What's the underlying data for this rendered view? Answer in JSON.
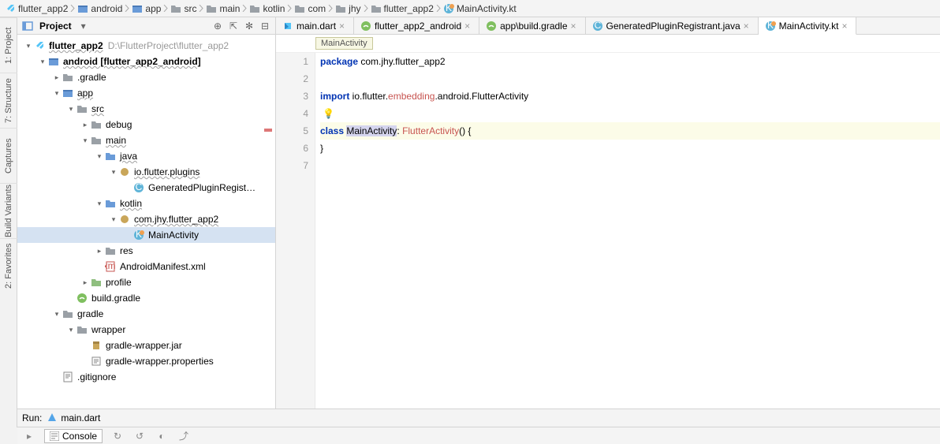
{
  "breadcrumbs": [
    "flutter_app2",
    "android",
    "app",
    "src",
    "main",
    "kotlin",
    "com",
    "jhy",
    "flutter_app2",
    "MainActivity.kt"
  ],
  "sidebar_tools": [
    "1: Project",
    "7: Structure",
    "Captures",
    "Build Variants",
    "2: Favorites"
  ],
  "project_panel": {
    "title": "Project"
  },
  "tree": [
    {
      "d": 0,
      "arr": "v",
      "icn": "flutter",
      "lab": "flutter_app2",
      "hint": "D:\\FlutterProject\\flutter_app2",
      "bold": true,
      "u": true
    },
    {
      "d": 1,
      "arr": "v",
      "icn": "module",
      "lab": "android  [flutter_app2_android]",
      "bold": true,
      "u": true
    },
    {
      "d": 2,
      "arr": ">",
      "icn": "folder-d",
      "lab": ".gradle"
    },
    {
      "d": 2,
      "arr": "v",
      "icn": "module",
      "lab": "app",
      "u": true
    },
    {
      "d": 3,
      "arr": "v",
      "icn": "folder-d",
      "lab": "src",
      "u": true
    },
    {
      "d": 4,
      "arr": ">",
      "icn": "folder-d",
      "lab": "debug"
    },
    {
      "d": 4,
      "arr": "v",
      "icn": "folder-d",
      "lab": "main",
      "u": true
    },
    {
      "d": 5,
      "arr": "v",
      "icn": "folder-b",
      "lab": "java",
      "u": true
    },
    {
      "d": 6,
      "arr": "v",
      "icn": "pkg",
      "lab": "io.flutter.plugins",
      "u": true
    },
    {
      "d": 7,
      "arr": "",
      "icn": "cfile",
      "lab": "GeneratedPluginRegist…"
    },
    {
      "d": 5,
      "arr": "v",
      "icn": "folder-b",
      "lab": "kotlin",
      "u": true
    },
    {
      "d": 6,
      "arr": "v",
      "icn": "pkg",
      "lab": "com.jhy.flutter_app2",
      "u": true
    },
    {
      "d": 7,
      "arr": "",
      "icn": "kfile",
      "lab": "MainActivity",
      "sel": true
    },
    {
      "d": 5,
      "arr": ">",
      "icn": "folder-d",
      "lab": "res"
    },
    {
      "d": 5,
      "arr": "",
      "icn": "xml",
      "lab": "AndroidManifest.xml"
    },
    {
      "d": 4,
      "arr": ">",
      "icn": "folder-g",
      "lab": "profile"
    },
    {
      "d": 3,
      "arr": "",
      "icn": "gradle",
      "lab": "build.gradle"
    },
    {
      "d": 2,
      "arr": "v",
      "icn": "folder-d",
      "lab": "gradle"
    },
    {
      "d": 3,
      "arr": "v",
      "icn": "folder-d",
      "lab": "wrapper"
    },
    {
      "d": 4,
      "arr": "",
      "icn": "jar",
      "lab": "gradle-wrapper.jar"
    },
    {
      "d": 4,
      "arr": "",
      "icn": "prop",
      "lab": "gradle-wrapper.properties"
    },
    {
      "d": 2,
      "arr": "",
      "icn": "txt",
      "lab": ".gitignore"
    }
  ],
  "tabs": [
    {
      "icn": "dart",
      "lab": "main.dart",
      "active": false
    },
    {
      "icn": "gradle",
      "lab": "flutter_app2_android",
      "active": false
    },
    {
      "icn": "gradle",
      "lab": "app\\build.gradle",
      "active": false
    },
    {
      "icn": "cfile",
      "lab": "GeneratedPluginRegistrant.java",
      "active": false
    },
    {
      "icn": "kfile",
      "lab": "MainActivity.kt",
      "active": true
    }
  ],
  "editor_crumb": "MainActivity",
  "code_lines": [
    {
      "n": 1,
      "html": "<span class='kw'>package</span> <span class='pkg'>com.jhy.flutter_app2</span>"
    },
    {
      "n": 2,
      "html": ""
    },
    {
      "n": 3,
      "html": "<span class='kw'>import</span> io.flutter.<span class='imp-orange'>embedding</span>.android.FlutterActivity"
    },
    {
      "n": 4,
      "html": " <span class='bulb'>💡</span>"
    },
    {
      "n": 5,
      "html": "<span class='kw'>class </span><span class='sel'>MainActivity</span>: <span class='cls'>FlutterActivity</span>() {",
      "cur": true,
      "mark": true
    },
    {
      "n": 6,
      "html": "}"
    },
    {
      "n": 7,
      "html": ""
    }
  ],
  "run": {
    "label": "Run:",
    "config": "main.dart"
  },
  "console": {
    "label": "Console"
  }
}
